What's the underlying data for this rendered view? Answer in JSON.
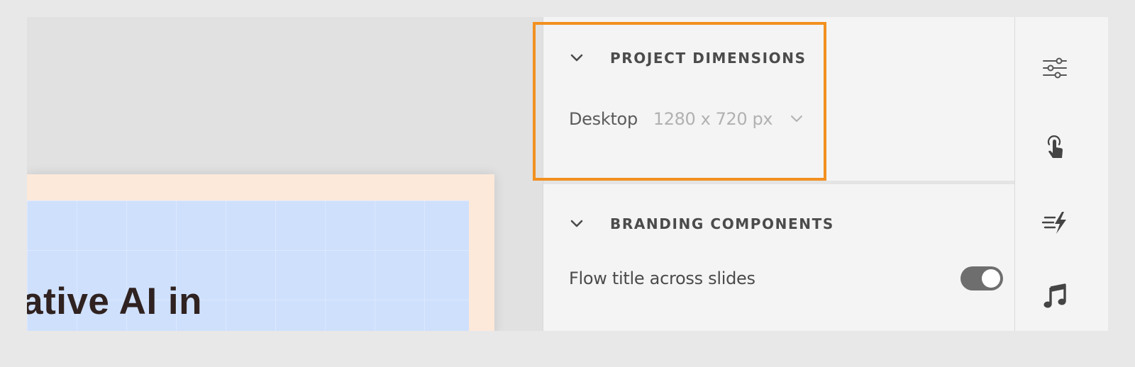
{
  "canvas": {
    "slide_title": "erative AI in"
  },
  "panel": {
    "project_dimensions": {
      "title": "PROJECT DIMENSIONS",
      "device_label": "Desktop",
      "dimension_value": "1280 x 720 px"
    },
    "branding_components": {
      "title": "BRANDING COMPONENTS",
      "flow_title_label": "Flow title across slides",
      "flow_title_enabled": true
    }
  },
  "rail": {
    "icons": [
      "properties-sliders-icon",
      "interaction-touch-icon",
      "animation-effects-icon",
      "audio-music-icon"
    ]
  },
  "colors": {
    "highlight": "#f29020",
    "toggle_on": "#6e6e6e",
    "slide_border": "#fde9da",
    "slide_fill": "#cfe0fd"
  }
}
